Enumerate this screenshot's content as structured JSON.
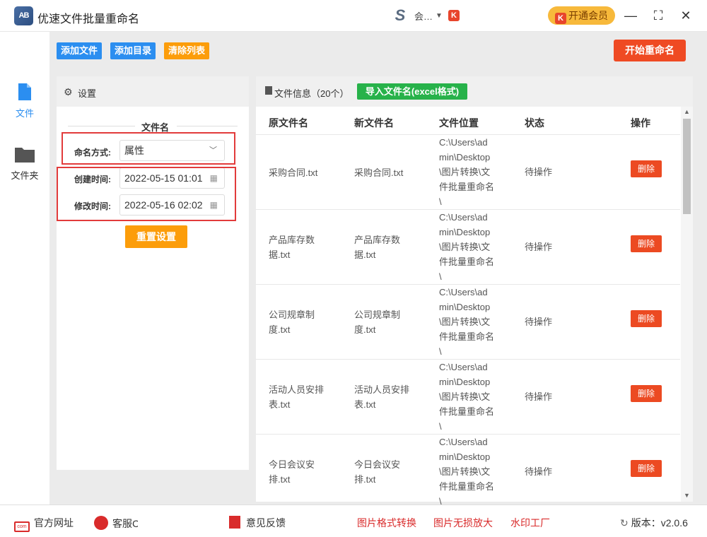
{
  "app": {
    "title": "优速文件批量重命名",
    "logo_text": "AB"
  },
  "user": {
    "name": "会…",
    "vip_button": "开通会员",
    "vip_mark": "K"
  },
  "window_controls": {
    "minimize": "—",
    "maximize": "⛶",
    "close": "✕"
  },
  "nav": {
    "items": [
      {
        "label": "文件"
      },
      {
        "label": "文件夹"
      }
    ]
  },
  "toolbar": {
    "add_file": "添加文件",
    "add_dir": "添加目录",
    "clear_list": "清除列表",
    "start": "开始重命名"
  },
  "settings": {
    "title": "设置",
    "section": "文件名",
    "naming_label": "命名方式:",
    "naming_value": "属性",
    "created_label": "创建时间:",
    "created_value": "2022-05-15 01:01",
    "modified_label": "修改时间:",
    "modified_value": "2022-05-16 02:02",
    "reset": "重置设置"
  },
  "files": {
    "title": "文件信息（20个）",
    "import_btn": "导入文件名(excel格式)",
    "columns": [
      "原文件名",
      "新文件名",
      "文件位置",
      "状态",
      "操作"
    ],
    "rows": [
      {
        "orig": [
          "采购合同.txt"
        ],
        "new": [
          "采购合同.txt"
        ],
        "status": "待操作",
        "action": "删除"
      },
      {
        "orig": [
          "产品库存数",
          "据.txt"
        ],
        "new": [
          "产品库存数",
          "据.txt"
        ],
        "status": "待操作",
        "action": "删除"
      },
      {
        "orig": [
          "公司规章制",
          "度.txt"
        ],
        "new": [
          "公司规章制",
          "度.txt"
        ],
        "status": "待操作",
        "action": "删除"
      },
      {
        "orig": [
          "活动人员安排",
          "表.txt"
        ],
        "new": [
          "活动人员安排",
          "表.txt"
        ],
        "status": "待操作",
        "action": "删除"
      },
      {
        "orig": [
          "今日会议安",
          "排.txt"
        ],
        "new": [
          "今日会议安",
          "排.txt"
        ],
        "status": "待操作",
        "action": "删除"
      }
    ],
    "location_lines": [
      "C:\\Users\\ad",
      "min\\Desktop",
      "\\图片转换\\文",
      "件批量重命名",
      "\\"
    ]
  },
  "footer": {
    "website": "官方网址",
    "service": "客服C",
    "feedback": "意见反馈",
    "img_convert": "图片格式转换",
    "img_enlarge": "图片无损放大",
    "watermark": "水印工厂",
    "version": "版本：v2.0.6"
  }
}
